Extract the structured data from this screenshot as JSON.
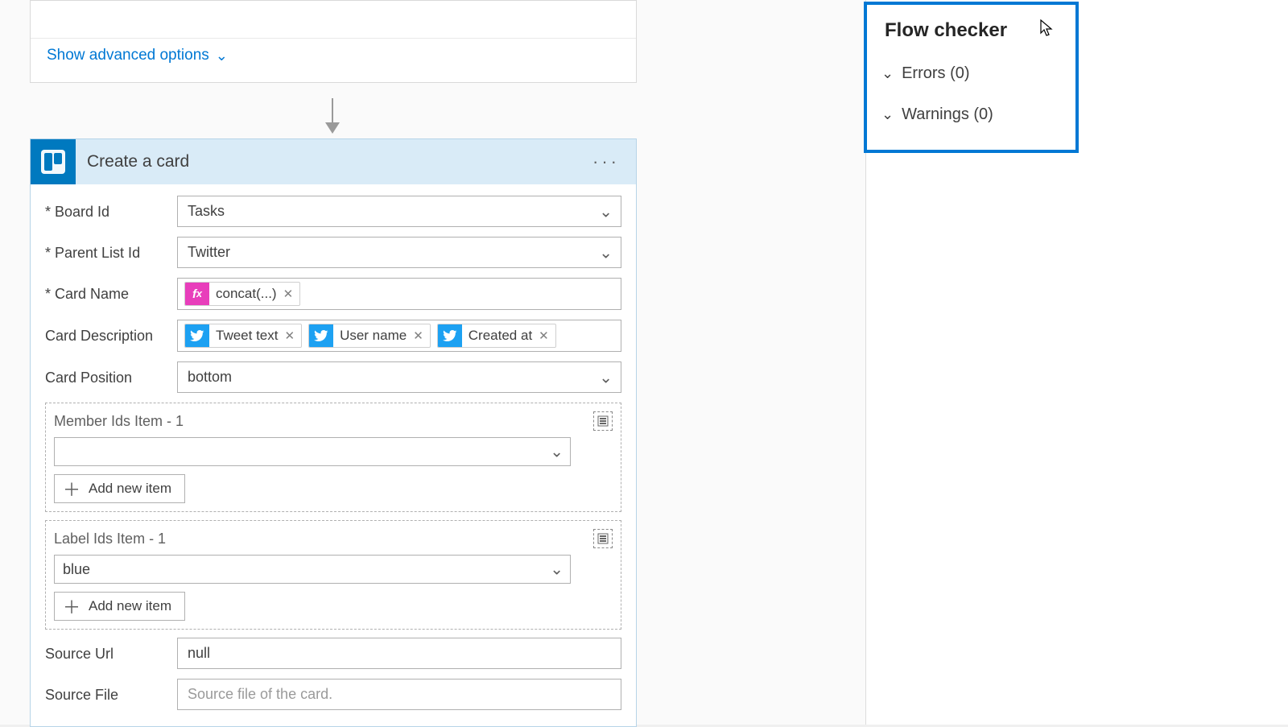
{
  "prev_action": {
    "advanced_label": "Show advanced options"
  },
  "action": {
    "title": "Create a card",
    "fields": {
      "board_id_label": "Board Id",
      "board_id_value": "Tasks",
      "parent_list_label": "Parent List Id",
      "parent_list_value": "Twitter",
      "card_name_label": "Card Name",
      "card_name_token": "concat(...)",
      "card_desc_label": "Card Description",
      "desc_tokens": {
        "t1": "Tweet text",
        "t2": "User name",
        "t3": "Created at"
      },
      "card_position_label": "Card Position",
      "card_position_value": "bottom",
      "member_group_label": "Member Ids Item - 1",
      "member_value": "",
      "add_item_label": "Add new item",
      "label_group_label": "Label Ids Item - 1",
      "label_value": "blue",
      "source_url_label": "Source Url",
      "source_url_value": "null",
      "source_file_label": "Source File",
      "source_file_placeholder": "Source file of the card."
    }
  },
  "checker": {
    "title": "Flow checker",
    "errors_label": "Errors (0)",
    "warnings_label": "Warnings (0)"
  }
}
